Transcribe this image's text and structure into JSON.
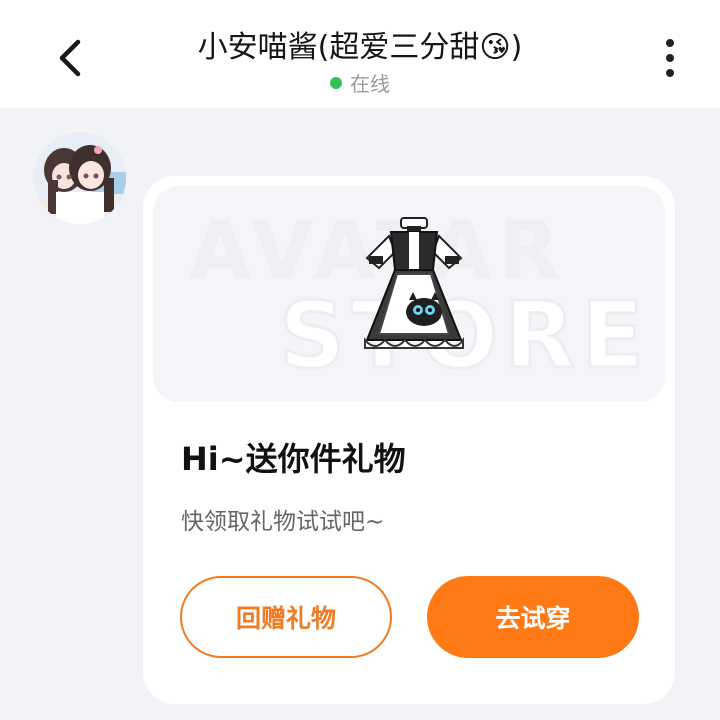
{
  "header": {
    "title": "小安喵酱(超爱三分甜😘)",
    "status_text": "在线",
    "status_color": "#31c25a",
    "back_icon": "chevron-left-icon",
    "more_icon": "more-vertical-icon"
  },
  "message": {
    "sender_avatar": "avatar",
    "card": {
      "banner_watermark_line1": "AVATAR",
      "banner_watermark_line2": "STORE",
      "image": "maid-dress-outfit",
      "title": "Hi~送你件礼物",
      "subtitle": "快领取礼物试试吧~",
      "secondary_button": "回赠礼物",
      "primary_button": "去试穿",
      "accent_color": "#ff7a14"
    }
  }
}
